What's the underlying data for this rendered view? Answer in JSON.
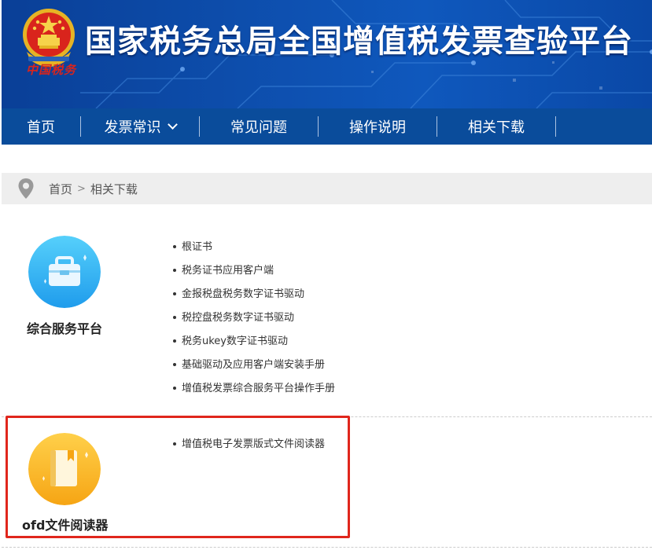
{
  "header": {
    "site_title": "国家税务总局全国增值税发票查验平台",
    "brand_script": "中国税务",
    "colors": {
      "banner": "#0d4dab",
      "nav": "#0a4c9b",
      "highlight": "#e0261c"
    }
  },
  "nav": {
    "items": [
      {
        "label": "首页"
      },
      {
        "label": "发票常识",
        "icon": "chevron-down-icon"
      },
      {
        "label": "常见问题"
      },
      {
        "label": "操作说明"
      },
      {
        "label": "相关下载"
      }
    ]
  },
  "breadcrumb": {
    "icon": "location-pin-icon",
    "home": "首页",
    "separator": ">",
    "current": "相关下载"
  },
  "sections": [
    {
      "title": "综合服务平台",
      "icon": "briefcase-icon",
      "color": "#35b4f4",
      "links": [
        "根证书",
        "税务证书应用客户端",
        "金报税盘税务数字证书驱动",
        "税控盘税务数字证书驱动",
        "税务ukey数字证书驱动",
        "基础驱动及应用客户端安装手册",
        "增值税发票综合服务平台操作手册"
      ]
    },
    {
      "title": "ofd文件阅读器",
      "icon": "book-icon",
      "color": "#f7b21f",
      "links": [
        "增值税电子发票版式文件阅读器"
      ]
    }
  ]
}
